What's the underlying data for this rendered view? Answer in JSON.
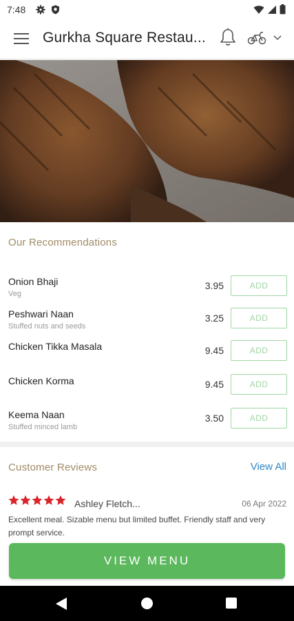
{
  "status_bar": {
    "time": "7:48",
    "icons": [
      "gear-icon",
      "shield-icon",
      "wifi-icon",
      "signal-icon",
      "battery-icon"
    ]
  },
  "app_bar": {
    "title": "Gurkha Square Restau...",
    "icons": [
      "menu-icon",
      "bell-icon",
      "delivery-bike-icon",
      "chevron-down-icon"
    ]
  },
  "recommendations": {
    "title": "Our Recommendations",
    "add_label": "ADD",
    "items": [
      {
        "name": "Onion Bhaji",
        "desc": "Veg",
        "price": "3.95"
      },
      {
        "name": "Peshwari Naan",
        "desc": "Stuffed nuts and seeds",
        "price": "3.25"
      },
      {
        "name": "Chicken Tikka Masala",
        "desc": "",
        "price": "9.45"
      },
      {
        "name": "Chicken Korma",
        "desc": "",
        "price": "9.45"
      },
      {
        "name": "Keema Naan",
        "desc": "Stuffed minced lamb",
        "price": "3.50"
      }
    ]
  },
  "reviews": {
    "title": "Customer Reviews",
    "view_all": "View All",
    "review": {
      "rating": 5,
      "reviewer": "Ashley Fletch...",
      "date": "06 Apr 2022",
      "text": "Excellent meal. Sizable menu but limited buffet. Friendly staff and very prompt service."
    }
  },
  "cta": {
    "label": "VIEW MENU"
  },
  "colors": {
    "accent_green": "#5cb85c",
    "add_border": "#9fd6a2",
    "section_title": "#a08a66",
    "link_blue": "#2f86c6",
    "star_red": "#d9242b"
  }
}
